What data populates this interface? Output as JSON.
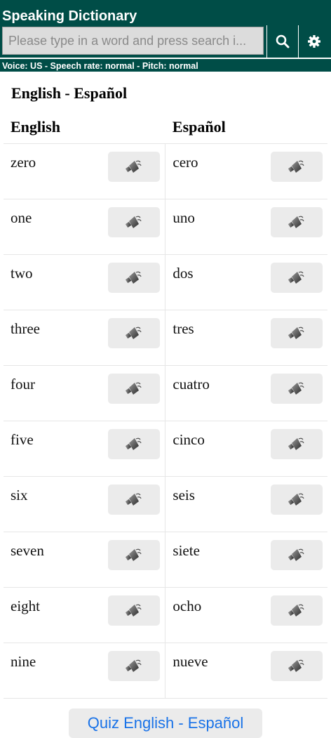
{
  "app": {
    "title": "Speaking Dictionary",
    "search_placeholder": "Please type in a word and press search i...",
    "search_icon": "search-icon",
    "settings_icon": "gear-icon",
    "voice_info": "Voice: US - Speech rate: normal - Pitch: normal"
  },
  "section": {
    "title": "English - Español",
    "col_left": "English",
    "col_right": "Español"
  },
  "rows": [
    {
      "en": "zero",
      "es": "cero"
    },
    {
      "en": "one",
      "es": "uno"
    },
    {
      "en": "two",
      "es": "dos"
    },
    {
      "en": "three",
      "es": "tres"
    },
    {
      "en": "four",
      "es": "cuatro"
    },
    {
      "en": "five",
      "es": "cinco"
    },
    {
      "en": "six",
      "es": "seis"
    },
    {
      "en": "seven",
      "es": "siete"
    },
    {
      "en": "eight",
      "es": "ocho"
    },
    {
      "en": "nine",
      "es": "nueve"
    }
  ],
  "speaker_icon": "speaker-icon",
  "quiz": {
    "label": "Quiz English - Español"
  },
  "colors": {
    "header_bg": "#004d47",
    "link_blue": "#1a73e8",
    "button_bg": "#ebebeb"
  }
}
